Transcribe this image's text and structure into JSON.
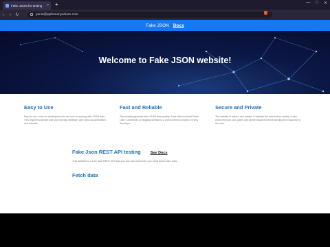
{
  "browser": {
    "tab_title": "Fake JSON for testing",
    "tab_close": "×",
    "new_tab": "+",
    "url": "yanis@pythonanywhere.com",
    "window_controls": [
      "—",
      "□",
      "✕"
    ],
    "nav": [
      "‹",
      "›",
      "↻",
      "⌂",
      "☆"
    ],
    "ext": [
      "⚙",
      "≡"
    ]
  },
  "site_nav": {
    "brand": "Fake JSON",
    "docs": "Docs"
  },
  "hero": {
    "title": "Welcome to Fake JSON website!"
  },
  "features": [
    {
      "title": "Easy to Use",
      "text": "Easy to use, even for developers who are new to working with JSON data. This requires a simple and user-friendly interface, with clear documentation and tutorials."
    },
    {
      "title": "Fast and Reliable",
      "text": "The website generate fake JSON data quickly. Fake data included Posts, User, Comments. A blogging website is a most common project of every developer."
    },
    {
      "title": "Secure and Private",
      "text": "The website is secure and private. It validate the data before saving. It also check the post, put, patch and delete requests before sending the response to the user."
    }
  ],
  "api": {
    "title": "Fake Json REST API testing",
    "link": "See Docs",
    "description": "This website is a free fake REST API that you can use whenever you need some fake data."
  },
  "fetch": {
    "title": "Fetch data"
  },
  "colors": {
    "accent": "#1b6fb8",
    "nav_bar": "#1678f2",
    "hero_bg": "#070a2b"
  }
}
